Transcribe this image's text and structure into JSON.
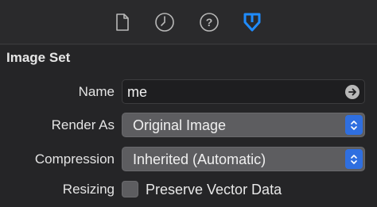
{
  "toolbar": {
    "icons": [
      "file-icon",
      "history-icon",
      "help-icon",
      "attributes-inspector-icon"
    ],
    "active_color": "#1f8cff",
    "inactive_color": "#b8b8b8"
  },
  "section": {
    "title": "Image Set"
  },
  "fields": {
    "name_label": "Name",
    "name_value": "me",
    "render_label": "Render As",
    "render_value": "Original Image",
    "compression_label": "Compression",
    "compression_value": "Inherited (Automatic)",
    "resizing_label": "Resizing",
    "preserve_label": "Preserve Vector Data",
    "preserve_checked": false
  },
  "colors": {
    "accent": "#2f6fe0"
  }
}
